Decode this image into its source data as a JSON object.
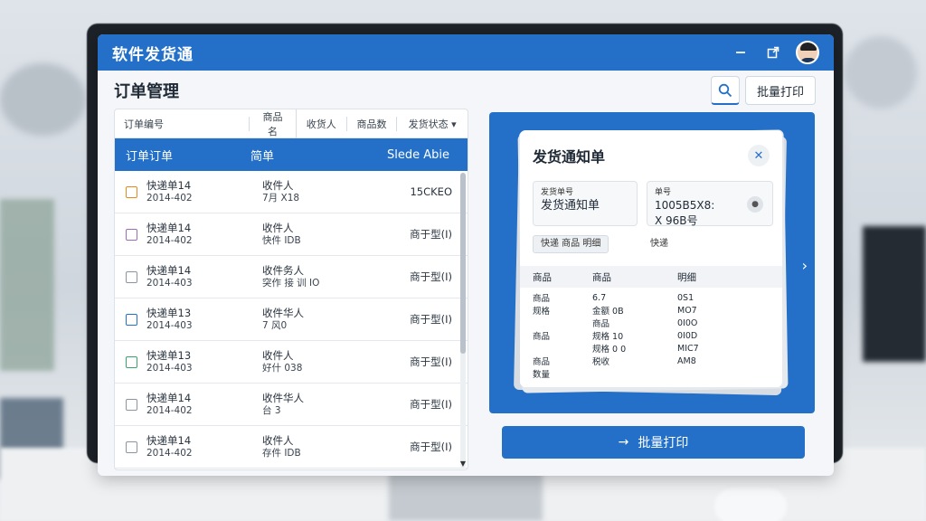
{
  "app": {
    "title": "软件发货通"
  },
  "page": {
    "title": "订单管理",
    "batch_print_top": "批量打印"
  },
  "table": {
    "headers": [
      "订单编号",
      "商品名",
      "收货人",
      "商品数",
      "发货状态 ▾"
    ],
    "selected_row": {
      "col1": "订单订单",
      "col2": "简单",
      "col3": "Slede Abie"
    },
    "rows": [
      {
        "id": "快递单14",
        "date": "2014-402",
        "name": "收件人",
        "sub": "7月 X18",
        "status": "15CKEO"
      },
      {
        "id": "快递单14",
        "date": "2014-402",
        "name": "收件人",
        "sub": "快件 IDB",
        "status": "商于型(I)"
      },
      {
        "id": "快递单14",
        "date": "2014-403",
        "name": "收件务人",
        "sub": "突作 接 训 IO",
        "status": "商于型(I)"
      },
      {
        "id": "快递单13",
        "date": "2014-403",
        "name": "收件华人",
        "sub": "7 风0",
        "status": "商于型(I)"
      },
      {
        "id": "快递单13",
        "date": "2014-403",
        "name": "收件人",
        "sub": "好什 038",
        "status": "商于型(I)"
      },
      {
        "id": "快递单14",
        "date": "2014-402",
        "name": "收件华人",
        "sub": "台 3",
        "status": "商于型(I)"
      },
      {
        "id": "快递单14",
        "date": "2014-402",
        "name": "收件人",
        "sub": "存件 IDB",
        "status": "商于型(I)"
      }
    ],
    "checkbox_colors": [
      "#e8891e",
      "#a06bb5",
      "#8b95a1",
      "#2470c9",
      "#3aa36a",
      "#8b95a1",
      "#8b95a1"
    ]
  },
  "notice": {
    "title": "发货通知单",
    "box_a_label": "发货单号",
    "box_a_value": "发货通知单",
    "box_b_label": "单号",
    "box_b_value_line1": "1005B5X8:",
    "box_b_value_line2": "X 96B号",
    "chip": "快递 商品 明细",
    "chip_right": "快递",
    "goods_headers": [
      "商品",
      "商品",
      "明细"
    ],
    "goods_rows": [
      [
        "商品",
        "6.7",
        "0S1"
      ],
      [
        "规格",
        "金额 0B",
        "MO7"
      ],
      [
        "",
        "商品",
        "0I0O"
      ],
      [
        "商品",
        "规格 10",
        "0I0D"
      ],
      [
        "",
        "规格 0 0",
        "MIC7"
      ],
      [
        "商品",
        "税收",
        "AM8"
      ],
      [
        "数量",
        "",
        ""
      ]
    ]
  },
  "actions": {
    "batch_print": "批量打印",
    "arrow": "→"
  },
  "colors": {
    "primary": "#2470c9",
    "background": "#f4f6f9"
  }
}
